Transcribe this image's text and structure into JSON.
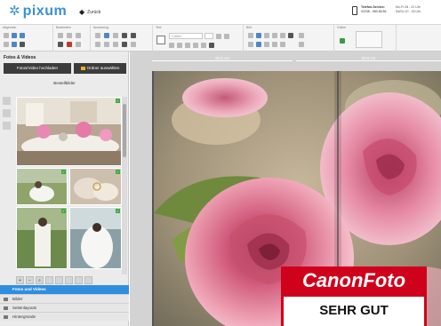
{
  "header": {
    "logo_text": "pixum",
    "back_label": "Zurück",
    "hotline_title": "Telefon-Service:",
    "hotline_number": "02238 - 980 86 86",
    "hours_line1": "Mo-Fr 08 - 22 Uhr",
    "hours_line2": "Sa/So 10 - 18 Uhr"
  },
  "ribbon": {
    "groups": [
      {
        "label": "Allgemein"
      },
      {
        "label": "Bearbeiten"
      },
      {
        "label": "Anordnung"
      },
      {
        "label": "Text"
      },
      {
        "label": "Bild"
      },
      {
        "label": "Online"
      }
    ],
    "font_value": "Calibri"
  },
  "sidebar": {
    "title": "Fotos & Videos",
    "upload_button": "Fotos/Video hochladen",
    "folder_button": "Ordner auswählen",
    "subtitle": "Bestellbilder",
    "accordion": [
      {
        "label": "Fotos und Videos",
        "active": true
      },
      {
        "label": "Bilder",
        "active": false
      },
      {
        "label": "Seitenlayouts",
        "active": false
      },
      {
        "label": "Hintergründe",
        "active": false
      }
    ]
  },
  "canvas": {
    "ruler_left": "20.5 cm",
    "ruler_right": "20.5 cm"
  },
  "badge": {
    "brand_part1": "Canon",
    "brand_part2": "Foto",
    "verdict": "SEHR GUT"
  },
  "colors": {
    "accent": "#2f8ee0",
    "logo": "#3a8fd6",
    "badge_red": "#d0011b"
  }
}
